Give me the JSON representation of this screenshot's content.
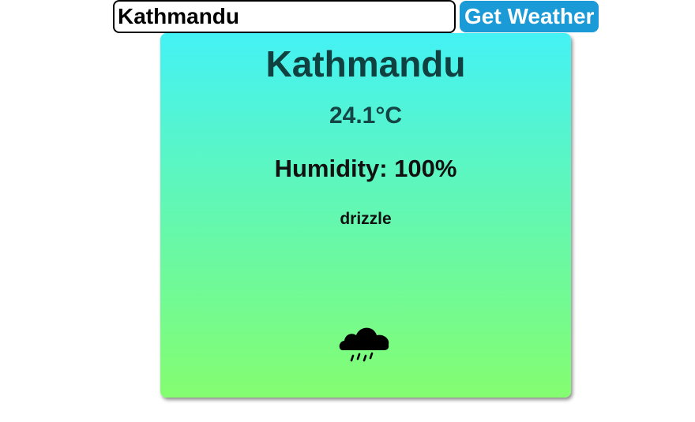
{
  "search": {
    "value": "Kathmandu",
    "button_label": "Get Weather"
  },
  "weather": {
    "city": "Kathmandu",
    "temperature": "24.1°C",
    "humidity": "Humidity: 100%",
    "description": "drizzle",
    "icon": "rain-cloud-icon"
  },
  "colors": {
    "button_bg": "#1a9ad6",
    "card_gradient_top": "#44f2f5",
    "card_gradient_bottom": "#84fd70"
  }
}
